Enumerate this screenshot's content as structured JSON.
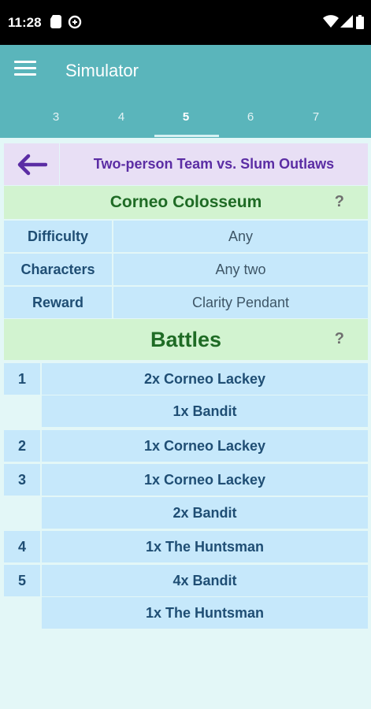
{
  "status": {
    "time": "11:28"
  },
  "appbar": {
    "title": "Simulator"
  },
  "tabs": [
    {
      "label": "3"
    },
    {
      "label": "4"
    },
    {
      "label": "5"
    },
    {
      "label": "6"
    },
    {
      "label": "7"
    }
  ],
  "active_tab": "5",
  "header": {
    "title": "Two-person Team vs. Slum Outlaws"
  },
  "location": {
    "name": "Corneo Colosseum",
    "help": "?"
  },
  "info": {
    "difficulty_label": "Difficulty",
    "difficulty_value": "Any",
    "characters_label": "Characters",
    "characters_value": "Any two",
    "reward_label": "Reward",
    "reward_value": "Clarity Pendant"
  },
  "battles": {
    "title": "Battles",
    "help": "?",
    "rows": [
      {
        "num": "1",
        "enemies": [
          "2x Corneo Lackey",
          "1x Bandit"
        ]
      },
      {
        "num": "2",
        "enemies": [
          "1x Corneo Lackey"
        ]
      },
      {
        "num": "3",
        "enemies": [
          "1x Corneo Lackey",
          "2x Bandit"
        ]
      },
      {
        "num": "4",
        "enemies": [
          "1x The Huntsman"
        ]
      },
      {
        "num": "5",
        "enemies": [
          "4x Bandit",
          "1x The Huntsman"
        ]
      }
    ]
  },
  "colors": {
    "appbar": "#5ab5bb",
    "header": "#e8dff5",
    "green": "#d2f3d0",
    "blue": "#c6e8fb"
  }
}
